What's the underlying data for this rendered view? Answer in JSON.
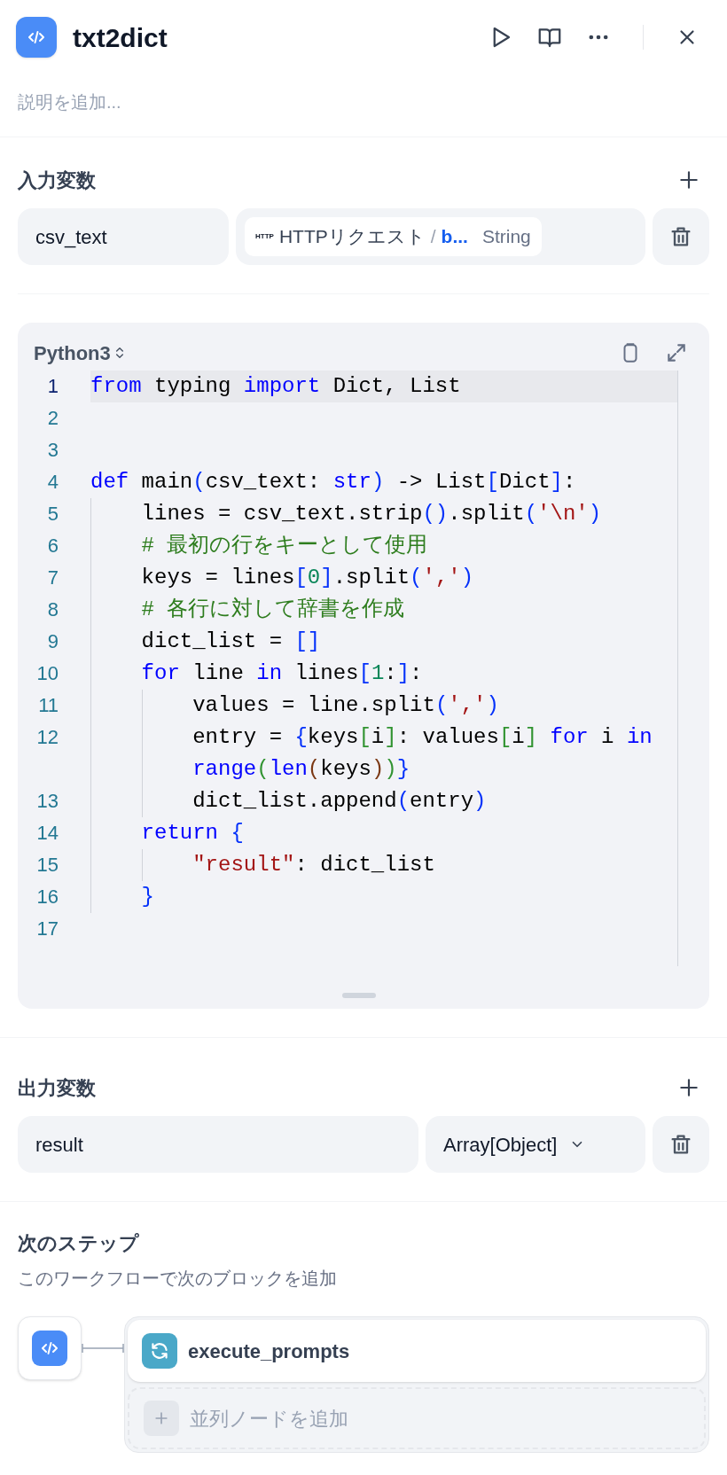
{
  "node": {
    "title": "txt2dict",
    "description_placeholder": "説明を追加..."
  },
  "input_variables": {
    "heading": "入力変数",
    "items": [
      {
        "name": "csv_text",
        "source": {
          "badge": "HTTP",
          "node": "HTTPリクエスト",
          "separator": "/",
          "field": "b...",
          "type": "String"
        }
      }
    ]
  },
  "code": {
    "language": "Python3",
    "lines": [
      {
        "number": "1",
        "active": true,
        "tokens": [
          {
            "kind": "keyword",
            "text": "from"
          },
          {
            "kind": "plain",
            "text": " typing "
          },
          {
            "kind": "keyword",
            "text": "import"
          },
          {
            "kind": "plain",
            "text": " Dict, List"
          }
        ]
      },
      {
        "number": "2",
        "active": false
      },
      {
        "number": "3",
        "active": false
      },
      {
        "number": "4",
        "active": false,
        "tokens": [
          {
            "kind": "keyword",
            "text": "def"
          },
          {
            "kind": "plain",
            "text": " main"
          },
          {
            "kind": "bracket1",
            "text": "("
          },
          {
            "kind": "plain",
            "text": "csv_text: "
          },
          {
            "kind": "keyword",
            "text": "str"
          },
          {
            "kind": "bracket1",
            "text": ")"
          },
          {
            "kind": "plain",
            "text": " -> List"
          },
          {
            "kind": "bracket1",
            "text": "["
          },
          {
            "kind": "plain",
            "text": "Dict"
          },
          {
            "kind": "bracket1",
            "text": "]"
          },
          {
            "kind": "plain",
            "text": ":"
          }
        ]
      },
      {
        "number": "5",
        "active": false,
        "tokens": [
          {
            "kind": "plain",
            "text": "    lines = csv_text.strip"
          },
          {
            "kind": "bracket1",
            "text": "()"
          },
          {
            "kind": "plain",
            "text": ".split"
          },
          {
            "kind": "bracket1",
            "text": "("
          },
          {
            "kind": "string",
            "text": "'\\n'"
          },
          {
            "kind": "bracket1",
            "text": ")"
          }
        ]
      },
      {
        "number": "6",
        "active": false,
        "tokens": [
          {
            "kind": "comment",
            "text": "    # 最初の行をキーとして使用"
          }
        ]
      },
      {
        "number": "7",
        "active": false,
        "tokens": [
          {
            "kind": "plain",
            "text": "    keys = lines"
          },
          {
            "kind": "bracket1",
            "text": "["
          },
          {
            "kind": "number",
            "text": "0"
          },
          {
            "kind": "bracket1",
            "text": "]"
          },
          {
            "kind": "plain",
            "text": ".split"
          },
          {
            "kind": "bracket1",
            "text": "("
          },
          {
            "kind": "string",
            "text": "','"
          },
          {
            "kind": "bracket1",
            "text": ")"
          }
        ]
      },
      {
        "number": "8",
        "active": false,
        "tokens": [
          {
            "kind": "comment",
            "text": "    # 各行に対して辞書を作成"
          }
        ]
      },
      {
        "number": "9",
        "active": false,
        "tokens": [
          {
            "kind": "plain",
            "text": "    dict_list = "
          },
          {
            "kind": "bracket1",
            "text": "[]"
          }
        ]
      },
      {
        "number": "10",
        "active": false,
        "tokens": [
          {
            "kind": "keyword",
            "text": "    for"
          },
          {
            "kind": "plain",
            "text": " line "
          },
          {
            "kind": "keyword",
            "text": "in"
          },
          {
            "kind": "plain",
            "text": " lines"
          },
          {
            "kind": "bracket1",
            "text": "["
          },
          {
            "kind": "number",
            "text": "1"
          },
          {
            "kind": "plain",
            "text": ":"
          },
          {
            "kind": "bracket1",
            "text": "]"
          },
          {
            "kind": "plain",
            "text": ":"
          }
        ]
      },
      {
        "number": "11",
        "active": false,
        "tokens": [
          {
            "kind": "plain",
            "text": "        values = line.split"
          },
          {
            "kind": "bracket1",
            "text": "("
          },
          {
            "kind": "string",
            "text": "','"
          },
          {
            "kind": "bracket1",
            "text": ")"
          }
        ]
      },
      {
        "number": "12",
        "active": false,
        "tokens": [
          {
            "kind": "plain",
            "text": "        entry = "
          },
          {
            "kind": "bracket1",
            "text": "{"
          },
          {
            "kind": "plain",
            "text": "keys"
          },
          {
            "kind": "bracket2",
            "text": "["
          },
          {
            "kind": "plain",
            "text": "i"
          },
          {
            "kind": "bracket2",
            "text": "]"
          },
          {
            "kind": "plain",
            "text": ": values"
          },
          {
            "kind": "bracket2",
            "text": "["
          },
          {
            "kind": "plain",
            "text": "i"
          },
          {
            "kind": "bracket2",
            "text": "]"
          },
          {
            "kind": "keyword",
            "text": " for"
          },
          {
            "kind": "plain",
            "text": " i "
          },
          {
            "kind": "keyword",
            "text": "in"
          },
          {
            "kind": "keyword",
            "text": " range"
          },
          {
            "kind": "bracket2",
            "text": "("
          },
          {
            "kind": "keyword",
            "text": "len"
          },
          {
            "kind": "bracket3",
            "text": "("
          },
          {
            "kind": "plain",
            "text": "keys"
          },
          {
            "kind": "bracket3",
            "text": ")"
          },
          {
            "kind": "bracket2",
            "text": ")"
          },
          {
            "kind": "bracket1",
            "text": "}"
          }
        ]
      },
      {
        "number": "13",
        "active": false,
        "tokens": [
          {
            "kind": "plain",
            "text": "        dict_list.append"
          },
          {
            "kind": "bracket1",
            "text": "("
          },
          {
            "kind": "plain",
            "text": "entry"
          },
          {
            "kind": "bracket1",
            "text": ")"
          }
        ]
      },
      {
        "number": "14",
        "active": false,
        "tokens": [
          {
            "kind": "keyword",
            "text": "    return"
          },
          {
            "kind": "bracket1",
            "text": " {"
          }
        ]
      },
      {
        "number": "15",
        "active": false,
        "tokens": [
          {
            "kind": "string",
            "text": "        \"result\""
          },
          {
            "kind": "plain",
            "text": ": dict_list"
          }
        ]
      },
      {
        "number": "16",
        "active": false,
        "tokens": [
          {
            "kind": "bracket1",
            "text": "    }"
          }
        ]
      },
      {
        "number": "17",
        "active": false
      }
    ]
  },
  "output_variables": {
    "heading": "出力変数",
    "items": [
      {
        "name": "result",
        "type": "Array[Object]"
      }
    ]
  },
  "next_step": {
    "heading": "次のステップ",
    "subtitle": "このワークフローで次のブロックを追加",
    "nodes": [
      {
        "label": "execute_prompts"
      }
    ],
    "add_parallel": "並列ノードを追加"
  }
}
